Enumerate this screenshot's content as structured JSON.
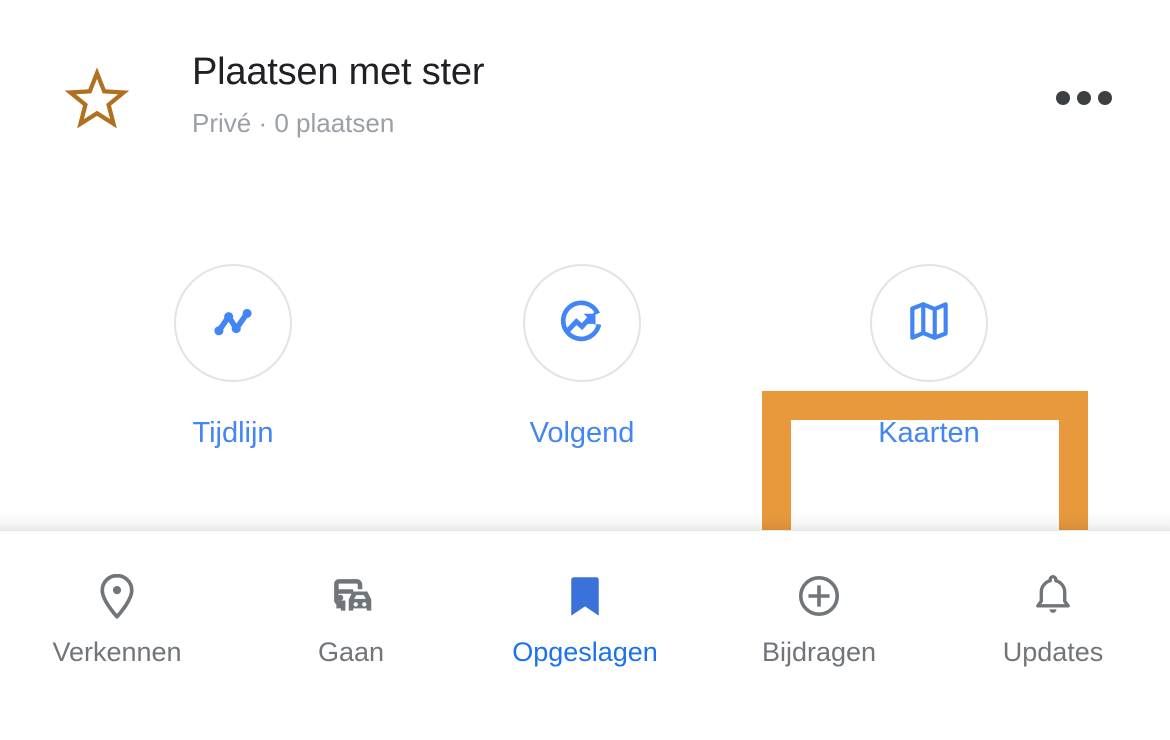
{
  "app": "google-maps-saved-list",
  "colors": {
    "blue": "#4285f4",
    "blue_nav_active": "#1a73e8",
    "gray_text": "#70757a",
    "subtitle_gray": "#9aa0a6",
    "title_dark": "#202124",
    "star_brown": "#b0701f",
    "highlight_orange": "#e8993c",
    "circle_border": "#e3e3e3",
    "dots_dark": "#3c4043"
  },
  "header": {
    "icon": "star-outline-icon",
    "title": "Plaatsen met ster",
    "subtitle": "Privé · 0 plaatsen",
    "overflow_icon": "more-horizontal-icon"
  },
  "actions": [
    {
      "id": "tijdlijn",
      "label": "Tijdlijn",
      "icon": "timeline-chart-icon",
      "highlighted": false
    },
    {
      "id": "volgend",
      "label": "Volgend",
      "icon": "trending-circle-icon",
      "highlighted": false
    },
    {
      "id": "kaarten",
      "label": "Kaarten",
      "icon": "map-folded-icon",
      "highlighted": true
    }
  ],
  "highlight": {
    "target": "kaarten",
    "color": "#e8993c",
    "border_width": 29
  },
  "bottom_nav": {
    "items": [
      {
        "id": "verkennen",
        "label": "Verkennen",
        "icon": "location-pin-icon",
        "active": false
      },
      {
        "id": "gaan",
        "label": "Gaan",
        "icon": "commute-icon",
        "active": false
      },
      {
        "id": "opgeslagen",
        "label": "Opgeslagen",
        "icon": "bookmark-filled-icon",
        "active": true
      },
      {
        "id": "bijdragen",
        "label": "Bijdragen",
        "icon": "plus-circle-icon",
        "active": false
      },
      {
        "id": "updates",
        "label": "Updates",
        "icon": "bell-icon",
        "active": false
      }
    ]
  }
}
